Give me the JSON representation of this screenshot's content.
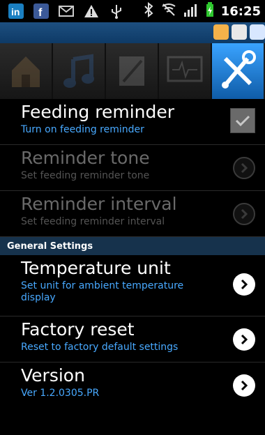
{
  "status_bar": {
    "time": "16:25"
  },
  "settings": {
    "feeding": {
      "title": "Feeding reminder",
      "subtitle": "Turn on feeding reminder",
      "checked": true
    },
    "tone": {
      "title": "Reminder tone",
      "subtitle": "Set feeding reminder tone"
    },
    "interval": {
      "title": "Reminder interval",
      "subtitle": "Set feeding reminder interval"
    },
    "section_header": "General Settings",
    "temperature": {
      "title": "Temperature unit",
      "subtitle": "Set unit for ambient temperature display"
    },
    "factory": {
      "title": "Factory reset",
      "subtitle": "Reset to factory default settings"
    },
    "version": {
      "title": "Version",
      "subtitle": "Ver 1.2.0305.PR"
    }
  },
  "colors": {
    "accent": "#48a9ff",
    "active_tab": "#1f7fd8",
    "section_bg": "#16324c"
  }
}
